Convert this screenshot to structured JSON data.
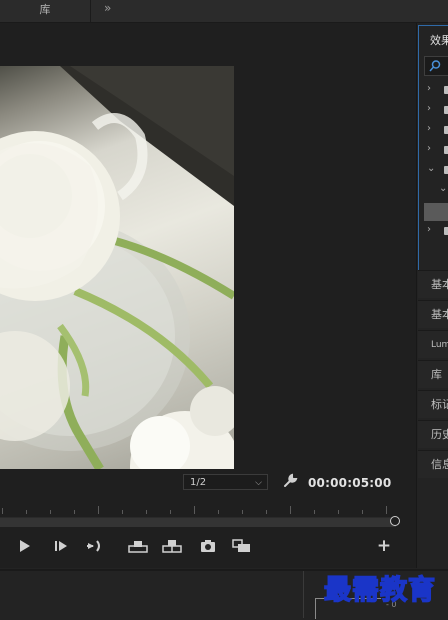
{
  "top_tabs": {
    "library_label": "库",
    "overflow_icon": "double-chevron-right"
  },
  "monitor": {
    "scale_select": {
      "value": "1/2",
      "caret": "⌵"
    },
    "timecode": "00:00:05:00"
  },
  "transport": {
    "buttons": [
      "play",
      "step-forward",
      "go-to-out",
      "lift",
      "extract",
      "export-frame",
      "multi-camera"
    ],
    "add_label": "+"
  },
  "effects_panel": {
    "title": "效果",
    "search_icon": "search-icon",
    "rows": [
      {
        "chevron": "›",
        "state": "collapsed"
      },
      {
        "chevron": "›",
        "state": "collapsed"
      },
      {
        "chevron": "›",
        "state": "collapsed"
      },
      {
        "chevron": "›",
        "state": "collapsed"
      },
      {
        "chevron": "⌄",
        "state": "expanded"
      },
      {
        "chevron": "⌄",
        "state": "expanded-child"
      },
      {
        "chevron": "",
        "state": "selected"
      },
      {
        "chevron": "›",
        "state": "collapsed"
      }
    ]
  },
  "collapsed_panels": [
    {
      "label": "基本"
    },
    {
      "label": "基本"
    },
    {
      "label": "Lumetri"
    },
    {
      "label": "库"
    },
    {
      "label": "标记"
    },
    {
      "label": "历史"
    },
    {
      "label": "信息"
    }
  ],
  "audio_meter": {
    "zero_label": "- 0"
  },
  "watermark": "最需教育",
  "colors": {
    "accent_border": "#2f6aa8",
    "watermark_stroke": "#1a35c8"
  }
}
